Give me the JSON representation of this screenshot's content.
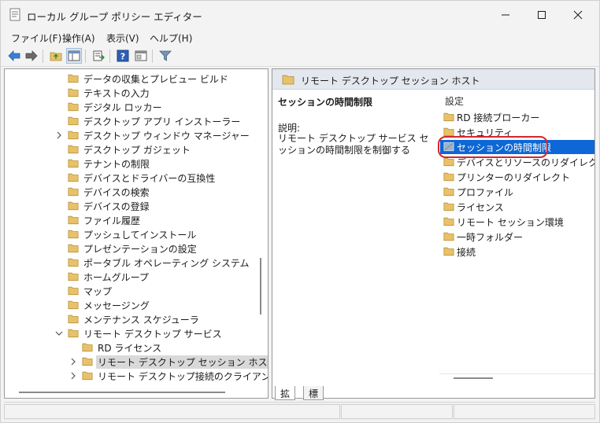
{
  "window": {
    "title": "ローカル グループ ポリシー エディター",
    "minimize_glyph": "—",
    "maximize_glyph": "☐",
    "close_glyph": "✕"
  },
  "menu": [
    {
      "label": "ファイル(F)"
    },
    {
      "label": "操作(A)"
    },
    {
      "label": "表示(V)"
    },
    {
      "label": "ヘルプ(H)"
    }
  ],
  "toolbar": {
    "icons": [
      "back-arrow-icon",
      "forward-arrow-icon",
      "up-folder-icon",
      "show-hide-tree-icon",
      "export-list-icon",
      "help-icon",
      "properties-icon",
      "filter-icon"
    ]
  },
  "tree": {
    "items": [
      {
        "label": "データの収集とプレビュー ビルド",
        "expander": "",
        "selected": false
      },
      {
        "label": "テキストの入力",
        "expander": "",
        "selected": false
      },
      {
        "label": "デジタル ロッカー",
        "expander": "",
        "selected": false
      },
      {
        "label": "デスクトップ アプリ インストーラー",
        "expander": "",
        "selected": false
      },
      {
        "label": "デスクトップ ウィンドウ マネージャー",
        "expander": "collapsed",
        "selected": false
      },
      {
        "label": "デスクトップ ガジェット",
        "expander": "",
        "selected": false
      },
      {
        "label": "テナントの制限",
        "expander": "",
        "selected": false
      },
      {
        "label": "デバイスとドライバーの互換性",
        "expander": "",
        "selected": false
      },
      {
        "label": "デバイスの検索",
        "expander": "",
        "selected": false
      },
      {
        "label": "デバイスの登録",
        "expander": "",
        "selected": false
      },
      {
        "label": "ファイル履歴",
        "expander": "",
        "selected": false
      },
      {
        "label": "プッシュしてインストール",
        "expander": "",
        "selected": false
      },
      {
        "label": "プレゼンテーションの設定",
        "expander": "",
        "selected": false
      },
      {
        "label": "ポータブル オペレーティング システム",
        "expander": "",
        "selected": false
      },
      {
        "label": "ホームグループ",
        "expander": "",
        "selected": false
      },
      {
        "label": "マップ",
        "expander": "",
        "selected": false
      },
      {
        "label": "メッセージング",
        "expander": "",
        "selected": false
      },
      {
        "label": "メンテナンス スケジューラ",
        "expander": "",
        "selected": false
      },
      {
        "label": "リモート デスクトップ サービス",
        "expander": "expanded",
        "selected": false
      },
      {
        "label": "RD ライセンス",
        "expander": "",
        "selected": false
      },
      {
        "label": "リモート デスクトップ セッション ホスト",
        "expander": "collapsed",
        "selected": true
      },
      {
        "label": "リモート デスクトップ接続のクライアント",
        "expander": "collapsed",
        "selected": false
      }
    ]
  },
  "right": {
    "header_title": "リモート デスクトップ セッション ホスト",
    "extended_title": "セッションの時間制限",
    "description_label": "説明:",
    "description": "リモート デスクトップ サービス セッションの時間制限を制御する",
    "column_header": "設定",
    "items": [
      {
        "label": "RD 接続ブローカー",
        "selected": false
      },
      {
        "label": "セキュリティ",
        "selected": false
      },
      {
        "label": "セッションの時間制限",
        "selected": true
      },
      {
        "label": "デバイスとリソースのリダイレクト",
        "selected": false
      },
      {
        "label": "プリンターのリダイレクト",
        "selected": false
      },
      {
        "label": "プロファイル",
        "selected": false
      },
      {
        "label": "ライセンス",
        "selected": false
      },
      {
        "label": "リモート セッション環境",
        "selected": false
      },
      {
        "label": "一時フォルダー",
        "selected": false
      },
      {
        "label": "接続",
        "selected": false
      }
    ]
  },
  "tabs": [
    {
      "label": "拡張",
      "active": true
    },
    {
      "label": "標準",
      "active": false
    }
  ],
  "colors": {
    "selection": "#0d67d6",
    "folder": "#e8c26a",
    "highlight_ring": "#d7252f"
  }
}
